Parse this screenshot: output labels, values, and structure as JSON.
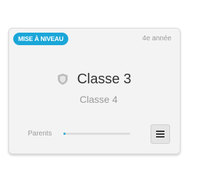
{
  "card": {
    "badge": "MISE À NIVEAU",
    "year": "4e année",
    "title": "Classe 3",
    "subtitle": "Classe 4",
    "parents_label": "Parents",
    "parents_progress_percent": 2,
    "shield_icon": "shield-icon",
    "menu_icon": "hamburger-menu-icon",
    "colors": {
      "accent": "#1aa6d8",
      "card_background": "#f3f3f3",
      "muted_text": "#9a9a9a",
      "title_text": "#333333"
    }
  }
}
